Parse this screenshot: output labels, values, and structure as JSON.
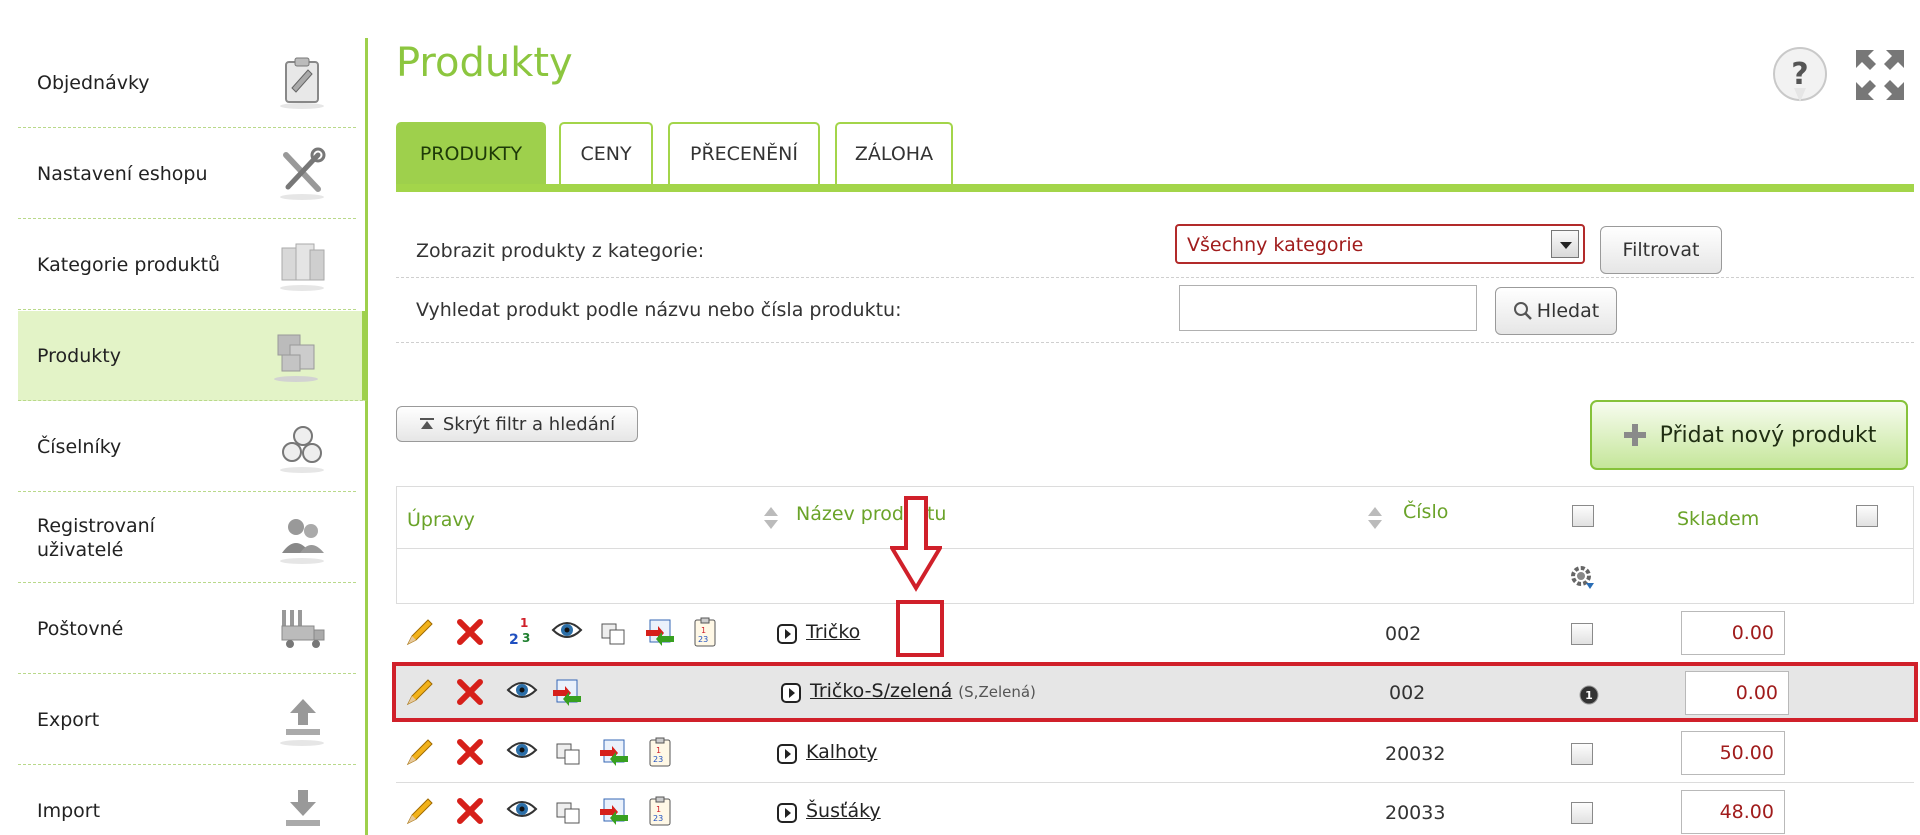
{
  "sidebar": {
    "items": [
      {
        "label": "Objednávky",
        "icon": "clipboard-icon"
      },
      {
        "label": "Nastavení eshopu",
        "icon": "tools-icon"
      },
      {
        "label": "Kategorie produktů",
        "icon": "boxes-icon"
      },
      {
        "label": "Produkty",
        "icon": "products-icon"
      },
      {
        "label": "Číselníky",
        "icon": "numbers-icon"
      },
      {
        "label": "Registrovaní uživatelé",
        "icon": "users-icon"
      },
      {
        "label": "Poštovné",
        "icon": "truck-icon"
      },
      {
        "label": "Export",
        "icon": "upload-icon"
      },
      {
        "label": "Import",
        "icon": "download-icon"
      }
    ],
    "active_item": "Produkty"
  },
  "header": {
    "title": "Produkty",
    "help_icon": "help-icon",
    "fullscreen_icon": "fullscreen-icon"
  },
  "tabs": [
    {
      "label": "PRODUKTY",
      "active": true
    },
    {
      "label": "CENY",
      "active": false
    },
    {
      "label": "PŘECENĚNÍ",
      "active": false
    },
    {
      "label": "ZÁLOHA",
      "active": false
    }
  ],
  "filter": {
    "category_label": "Zobrazit produkty z kategorie:",
    "category_value": "Všechny kategorie",
    "filter_button": "Filtrovat",
    "search_label": "Vyhledat produkt podle názvu nebo čísla produktu:",
    "search_value": "",
    "search_button": "Hledat",
    "hide_filter_button": "Skrýt filtr a hledání"
  },
  "add_product_button": "Přidat nový produkt",
  "table": {
    "headers": {
      "edits": "Úpravy",
      "name": "Název produktu",
      "number": "Číslo",
      "stock": "Skladem"
    },
    "rows": [
      {
        "name": "Tričko",
        "variant": "",
        "number": "002",
        "stock": "0.00",
        "is_variant": false
      },
      {
        "name": "Tričko-S/zelená",
        "variant": "(S,Zelená)",
        "number": "002",
        "stock": "0.00",
        "is_variant": true
      },
      {
        "name": "Kalhoty",
        "variant": "",
        "number": "20032",
        "stock": "50.00",
        "is_variant": false
      },
      {
        "name": "Šusťáky",
        "variant": "",
        "number": "20033",
        "stock": "48.00",
        "is_variant": false
      }
    ]
  },
  "annotation_colors": {
    "highlight": "#d0202a",
    "accent": "#9ed04c"
  }
}
